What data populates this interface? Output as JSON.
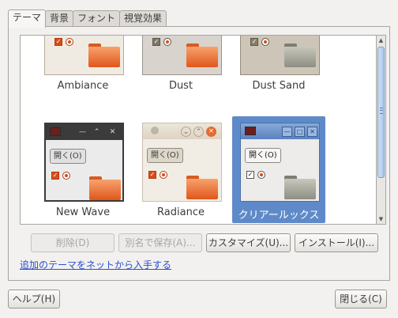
{
  "tabs": [
    {
      "label": "テーマ"
    },
    {
      "label": "背景"
    },
    {
      "label": "フォント"
    },
    {
      "label": "視覚効果"
    }
  ],
  "themes": [
    {
      "name": "Ambiance"
    },
    {
      "name": "Dust"
    },
    {
      "name": "Dust Sand"
    },
    {
      "name": "New Wave",
      "open_label": "開く(O)"
    },
    {
      "name": "Radiance",
      "open_label": "開く(O)"
    },
    {
      "name": "クリアールックス",
      "open_label": "開く(O)",
      "selected": true
    }
  ],
  "buttons": {
    "delete": "削除(D)",
    "save_as": "別名で保存(A)...",
    "customize": "カスタマイズ(U)...",
    "install": "インストール(I)..."
  },
  "link_text": "追加のテーマをネットから入手する",
  "footer": {
    "help": "ヘルプ(H)",
    "close": "閉じる(C)"
  },
  "colors": {
    "selection": "#5f8ac9",
    "link": "#2a4fcf",
    "accent_orange": "#d64d16"
  }
}
